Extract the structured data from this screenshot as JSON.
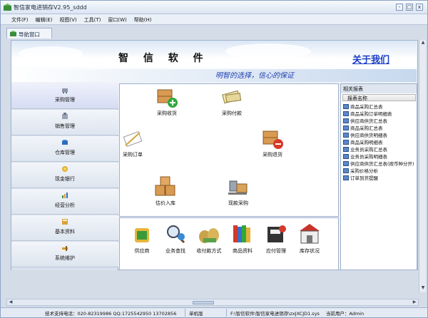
{
  "window": {
    "title": "智信家电进销存V2.95_sddd",
    "min_label": "-",
    "max_label": "□",
    "close_label": "x"
  },
  "menubar": {
    "items": [
      "文件(F)",
      "编辑(E)",
      "视图(V)",
      "工具(T)",
      "窗口(W)",
      "帮助(H)"
    ]
  },
  "nav_tab": {
    "label": "导航窗口"
  },
  "banner": {
    "brand": "智 信 软 件",
    "about_link": "关于我们",
    "slogan": "明智的选择，信心的保证"
  },
  "left_nav": {
    "items": [
      {
        "label": "采购管理",
        "icon": "cart-icon"
      },
      {
        "label": "销售管理",
        "icon": "sales-icon"
      },
      {
        "label": "仓库管理",
        "icon": "warehouse-icon"
      },
      {
        "label": "现金银行",
        "icon": "cash-icon"
      },
      {
        "label": "经营分析",
        "icon": "analysis-icon"
      },
      {
        "label": "基本资料",
        "icon": "basic-data-icon"
      },
      {
        "label": "系统维护",
        "icon": "maintenance-icon"
      }
    ]
  },
  "workarea": {
    "items": [
      {
        "label": "采购收货",
        "icon": "receive-goods-icon"
      },
      {
        "label": "采购付款",
        "icon": "payment-icon"
      },
      {
        "label": "采购订单",
        "icon": "purchase-order-icon"
      },
      {
        "label": "采购退货",
        "icon": "return-goods-icon"
      },
      {
        "label": "估价入库",
        "icon": "estimate-stock-icon"
      },
      {
        "label": "现款采购",
        "icon": "cash-purchase-icon"
      }
    ]
  },
  "bottom_bar": {
    "items": [
      {
        "label": "供应商",
        "icon": "supplier-icon"
      },
      {
        "label": "业务查找",
        "icon": "search-business-icon"
      },
      {
        "label": "收付款方式",
        "icon": "money-bags-icon"
      },
      {
        "label": "商品资料",
        "icon": "books-icon"
      },
      {
        "label": "应付管理",
        "icon": "payable-icon"
      },
      {
        "label": "库存状况",
        "icon": "store-icon"
      }
    ]
  },
  "reports": {
    "panel_title": "相关报表",
    "column_header": "报表名称",
    "items": [
      "商品采购汇总表",
      "商品采购订单明细表",
      "供应商供货汇总表",
      "商品采购汇总表",
      "供应商供货明细表",
      "商品采购明细表",
      "业务员采购汇总表",
      "业务员采购明细表",
      "供应商供货汇总表(按币种分开)",
      "采购价格分析",
      "订单到货提醒"
    ]
  },
  "status_bar": {
    "support": "技术支持电话：020-82319986 QQ:1725542950 13702856",
    "edition": "单机版",
    "db_path": "F:\\智信软件\\智信家电进销存\\zxJXCJD1.sys",
    "user": "当前用户：Admin"
  },
  "colors": {
    "accent": "#1a3ec8",
    "slogan": "#1e3eae",
    "window_bg": "#d4dce8"
  }
}
